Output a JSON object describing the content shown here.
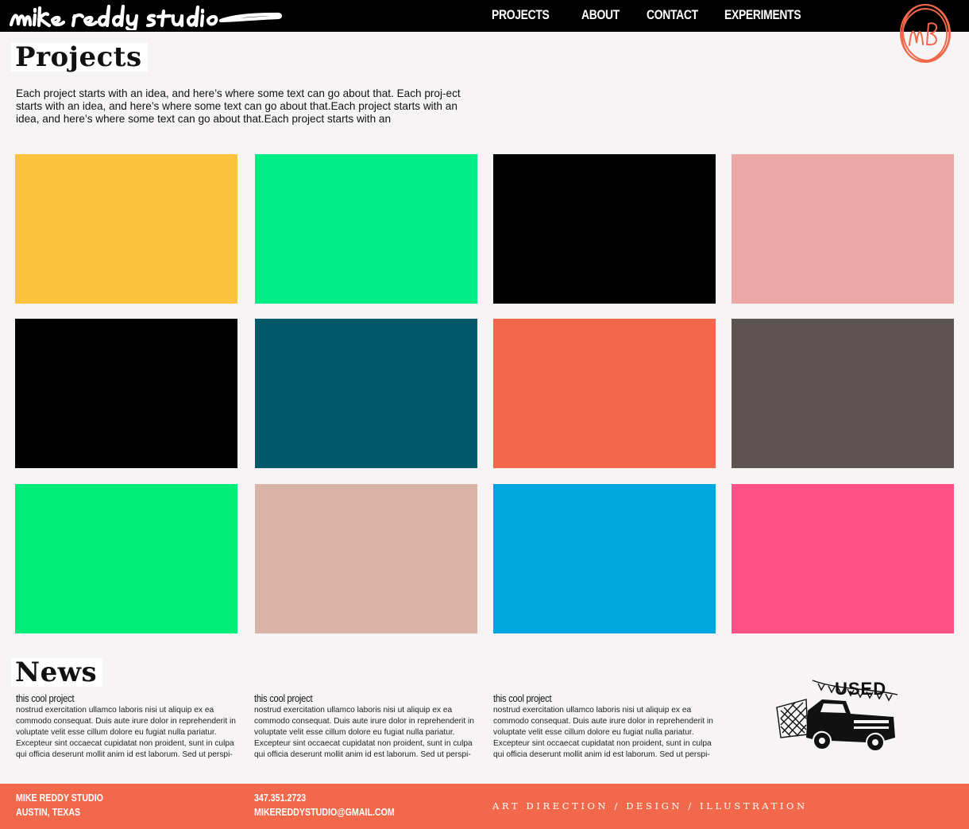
{
  "header": {
    "logo_text": "mike reddy studio",
    "nav": [
      "PROJECTS",
      "ABOUT",
      "CONTACT",
      "EXPERIMENTS"
    ],
    "badge_text": "MR"
  },
  "projects": {
    "title": "Projects",
    "intro": "Each project starts with an idea, and here’s where some text can go about that. Each proj-ect starts with an idea, and here’s where some text can go about that.Each project starts with an idea, and here’s where some text can go about that.Each project starts with an",
    "tile_colors": [
      "#fdc23c",
      "#00ec84",
      "#000000",
      "#eca8a6",
      "#000000",
      "#00586b",
      "#f2684a",
      "#5d5353",
      "#00ec78",
      "#d9b4a7",
      "#00a7de",
      "#ff5185"
    ]
  },
  "news": {
    "title": "News",
    "items": [
      {
        "title": "this cool project",
        "body": "nostrud exercitation ullamco laboris nisi ut aliquip ex ea commodo consequat. Duis aute irure dolor in reprehenderit in voluptate velit esse cillum dolore eu fugiat nulla pariatur. Excepteur sint occaecat cupidatat non proident, sunt in culpa qui officia deserunt mollit anim id est laborum. Sed ut perspi-"
      },
      {
        "title": "this cool project",
        "body": "nostrud exercitation ullamco laboris nisi ut aliquip ex ea commodo consequat. Duis aute irure dolor in reprehenderit in voluptate velit esse cillum dolore eu fugiat nulla pariatur. Excepteur sint occaecat cupidatat non proident, sunt in culpa qui officia deserunt mollit anim id est laborum. Sed ut perspi-"
      },
      {
        "title": "this cool project",
        "body": "nostrud exercitation ullamco laboris nisi ut aliquip ex ea commodo consequat. Duis aute irure dolor in reprehenderit in voluptate velit esse cillum dolore eu fugiat nulla pariatur. Excepteur sint occaecat cupidatat non proident, sunt in culpa qui officia deserunt mollit anim id est laborum. Sed ut perspi-"
      }
    ],
    "illustration_text": "USED"
  },
  "footer": {
    "name": "MIKE REDDY STUDIO",
    "location": "AUSTIN, TEXAS",
    "phone": "347.351.2723",
    "email": "MIKEREDDYSTUDIO@GMAIL.COM",
    "tagline": "ART DIRECTION / DESIGN / ILLUSTRATION"
  },
  "colors": {
    "accent": "#f2684a",
    "header_bg": "#000000",
    "page_bg": "#f6f4f4"
  }
}
